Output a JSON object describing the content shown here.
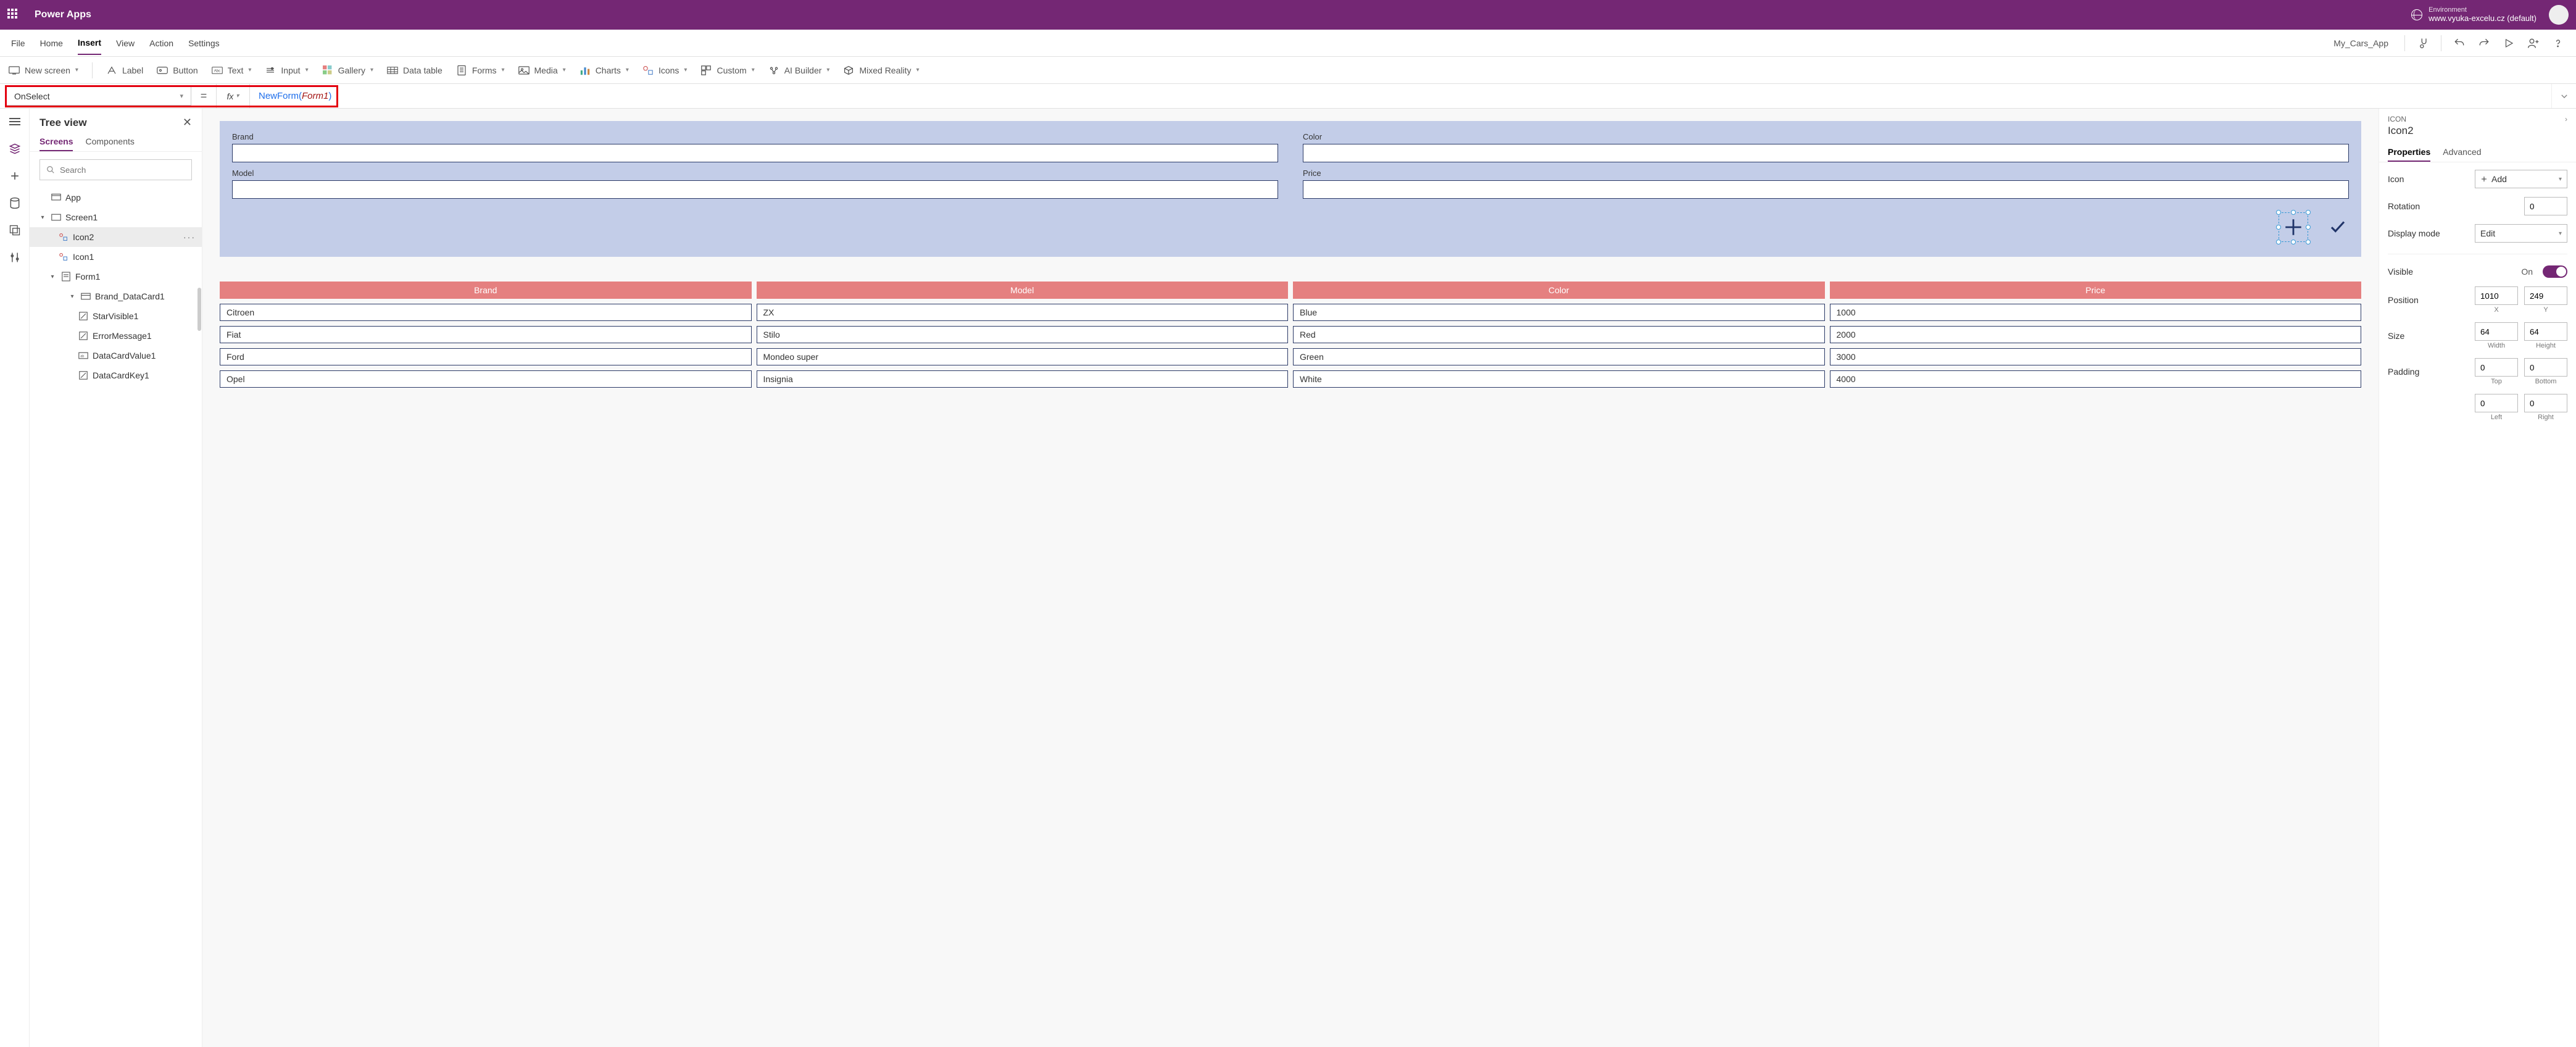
{
  "header": {
    "product": "Power Apps",
    "env_label": "Environment",
    "env_value": "www.vyuka-excelu.cz (default)"
  },
  "menu": {
    "items": [
      "File",
      "Home",
      "Insert",
      "View",
      "Action",
      "Settings"
    ],
    "active": "Insert",
    "app_name": "My_Cars_App"
  },
  "ribbon": {
    "new_screen": "New screen",
    "label": "Label",
    "button": "Button",
    "text": "Text",
    "input": "Input",
    "gallery": "Gallery",
    "data_table": "Data table",
    "forms": "Forms",
    "media": "Media",
    "charts": "Charts",
    "icons": "Icons",
    "custom": "Custom",
    "ai_builder": "AI Builder",
    "mixed_reality": "Mixed Reality"
  },
  "formula": {
    "property": "OnSelect",
    "fn": "NewForm",
    "arg": "Form1"
  },
  "tree": {
    "title": "Tree view",
    "tabs": {
      "screens": "Screens",
      "components": "Components"
    },
    "search": "Search",
    "root": "App",
    "nodes": {
      "screen1": "Screen1",
      "icon2": "Icon2",
      "icon1": "Icon1",
      "form1": "Form1",
      "brand_dc": "Brand_DataCard1",
      "starvisible": "StarVisible1",
      "errormsg": "ErrorMessage1",
      "dcv": "DataCardValue1",
      "dck": "DataCardKey1"
    }
  },
  "form": {
    "fields": {
      "brand": "Brand",
      "model": "Model",
      "color": "Color",
      "price": "Price"
    }
  },
  "table": {
    "headers": [
      "Brand",
      "Model",
      "Color",
      "Price"
    ],
    "rows": [
      [
        "Citroen",
        "ZX",
        "Blue",
        "1000"
      ],
      [
        "Fiat",
        "Stilo",
        "Red",
        "2000"
      ],
      [
        "Ford",
        "Mondeo super",
        "Green",
        "3000"
      ],
      [
        "Opel",
        "Insignia",
        "White",
        "4000"
      ]
    ]
  },
  "props": {
    "crumb": "ICON",
    "name": "Icon2",
    "tabs": {
      "properties": "Properties",
      "advanced": "Advanced"
    },
    "icon_label": "Icon",
    "icon_value": "Add",
    "rotation_label": "Rotation",
    "rotation_value": "0",
    "display_label": "Display mode",
    "display_value": "Edit",
    "visible_label": "Visible",
    "visible_value": "On",
    "position_label": "Position",
    "position_x": "1010",
    "position_y": "249",
    "x": "X",
    "y": "Y",
    "size_label": "Size",
    "size_w": "64",
    "size_h": "64",
    "w": "Width",
    "h": "Height",
    "padding_label": "Padding",
    "pad_t": "0",
    "pad_b": "0",
    "pad_l": "0",
    "pad_r": "0",
    "top": "Top",
    "bottom": "Bottom",
    "left": "Left",
    "right": "Right"
  }
}
